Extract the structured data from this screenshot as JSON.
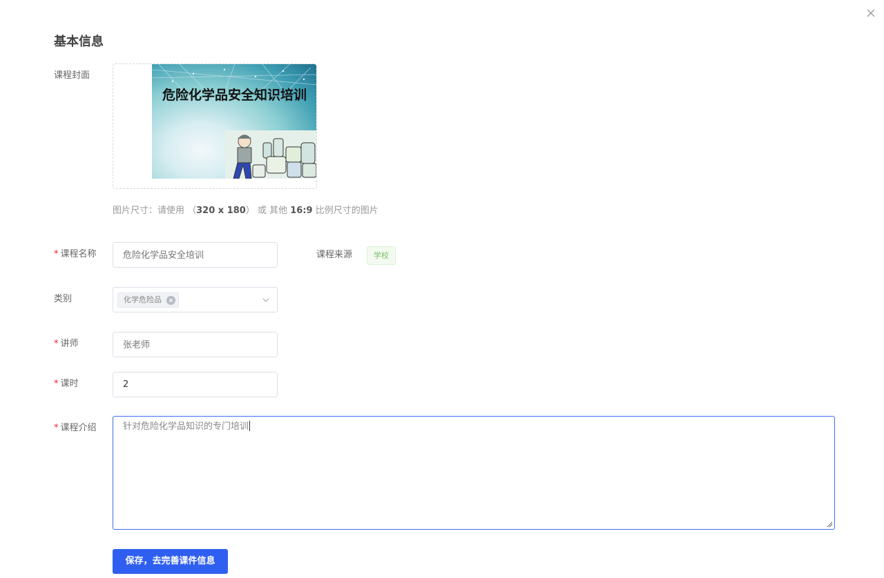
{
  "window": {
    "close_icon": "close-icon"
  },
  "section": {
    "title": "基本信息"
  },
  "cover": {
    "label": "课程封面",
    "image_text": "危险化学品安全知识培训",
    "hint_prefix": "图片尺寸：请使用 （",
    "hint_size": "320 x 180",
    "hint_middle": "） 或 其他 ",
    "hint_ratio": "16:9",
    "hint_suffix": " 比例尺寸的图片"
  },
  "course_name": {
    "required": "*",
    "label": "课程名称",
    "placeholder": "危险化学品安全培训"
  },
  "course_source": {
    "label": "课程来源",
    "tag": "学校",
    "tag_color": "#7bbd6a"
  },
  "category": {
    "label": "类别",
    "selected_tag": "化学危险品",
    "arrow_icon": "chevron-down-icon"
  },
  "teacher": {
    "required": "*",
    "label": "讲师",
    "placeholder": "张老师"
  },
  "hours": {
    "required": "*",
    "label": "课时",
    "value": "2"
  },
  "intro": {
    "required": "*",
    "label": "课程介绍",
    "value": "针对危险化学品知识的专门培训"
  },
  "actions": {
    "save_label": "保存，去完善课件信息",
    "accent_color": "#2f5ff0"
  }
}
